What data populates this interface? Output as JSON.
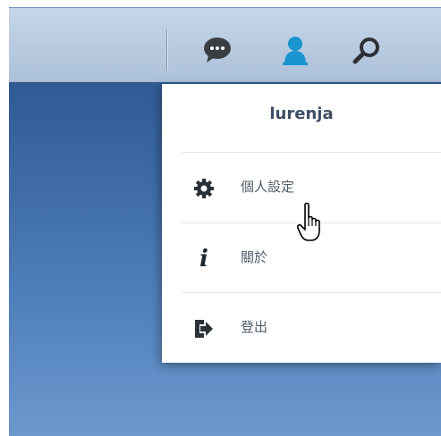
{
  "taskbar": {
    "icons": [
      "chat-bubble-icon",
      "user-icon",
      "search-icon"
    ],
    "accent": "#1a94cf",
    "chat_color": "#3b3f44"
  },
  "user_menu": {
    "username": "lurenja",
    "items": [
      {
        "label": "個人設定",
        "icon": "gear-icon"
      },
      {
        "label": "關於",
        "icon": "info-icon"
      },
      {
        "label": "登出",
        "icon": "logout-icon"
      }
    ]
  },
  "cursor": {
    "icon": "hand-pointer-icon"
  }
}
